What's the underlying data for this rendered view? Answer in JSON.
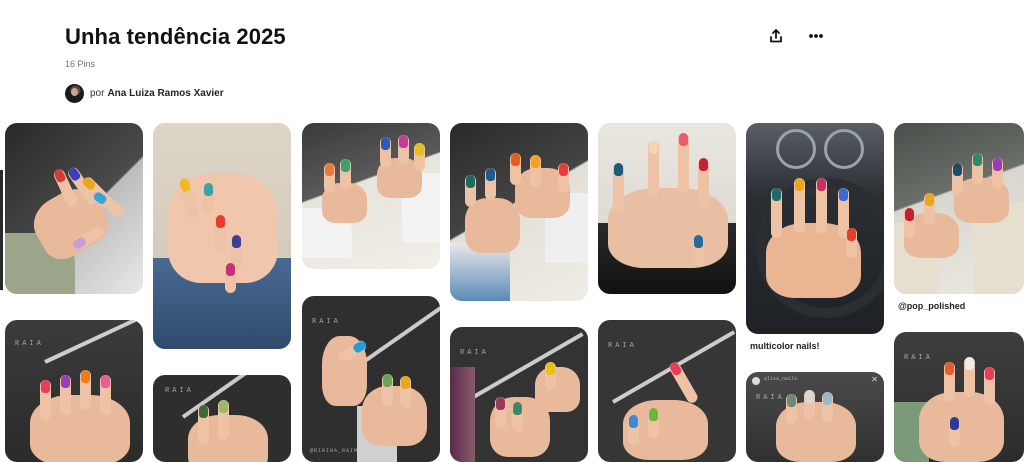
{
  "board": {
    "title": "Unha tendência 2025",
    "pin_count": "16 Pins",
    "owner_prefix": "por",
    "owner_name": "Ana Luiza Ramos Xavier"
  },
  "actions": {
    "share_icon": "share-icon",
    "more_icon": "more-options-icon"
  },
  "pins": [
    {
      "id": "pin-1",
      "caption": ""
    },
    {
      "id": "pin-2",
      "caption": ""
    },
    {
      "id": "pin-3",
      "caption": ""
    },
    {
      "id": "pin-4",
      "caption": ""
    },
    {
      "id": "pin-5",
      "caption": ""
    },
    {
      "id": "pin-6",
      "caption": "multicolor nails!"
    },
    {
      "id": "pin-7",
      "caption": "@pop_polished"
    },
    {
      "id": "pin-8",
      "caption": ""
    },
    {
      "id": "pin-9",
      "caption": ""
    },
    {
      "id": "pin-10",
      "caption": ""
    },
    {
      "id": "pin-11",
      "caption": ""
    },
    {
      "id": "pin-12",
      "caption": ""
    },
    {
      "id": "pin-13",
      "caption": ""
    },
    {
      "id": "pin-14",
      "caption": ""
    }
  ],
  "overlay_text": {
    "wall_logo": "RAIA",
    "watermark": "@RIRINA_RAIM",
    "story_user": "alisa_nails"
  },
  "colors": {
    "title": "#111111",
    "muted": "#767676",
    "background": "#ffffff"
  }
}
